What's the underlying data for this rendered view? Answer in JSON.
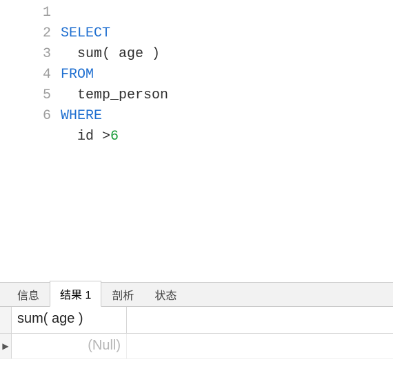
{
  "editor": {
    "line_numbers": [
      "1",
      "2",
      "3",
      "4",
      "5",
      "6"
    ],
    "tokens": [
      [
        {
          "t": "SELECT",
          "c": "kw"
        }
      ],
      [
        {
          "t": "  ",
          "c": "ident"
        },
        {
          "t": "sum",
          "c": "ident"
        },
        {
          "t": "( age )",
          "c": "ident"
        }
      ],
      [
        {
          "t": "FROM",
          "c": "kw"
        }
      ],
      [
        {
          "t": "  temp_person",
          "c": "ident"
        }
      ],
      [
        {
          "t": "WHERE",
          "c": "kw"
        }
      ],
      [
        {
          "t": "  id >",
          "c": "ident"
        },
        {
          "t": "6",
          "c": "num"
        }
      ]
    ]
  },
  "tabs": {
    "items": [
      {
        "label": "信息",
        "active": false
      },
      {
        "label": "结果 1",
        "active": true
      },
      {
        "label": "剖析",
        "active": false
      },
      {
        "label": "状态",
        "active": false
      }
    ]
  },
  "results": {
    "row_marker": "▶",
    "columns": [
      "sum( age )"
    ],
    "rows": [
      [
        "(Null)"
      ]
    ]
  }
}
